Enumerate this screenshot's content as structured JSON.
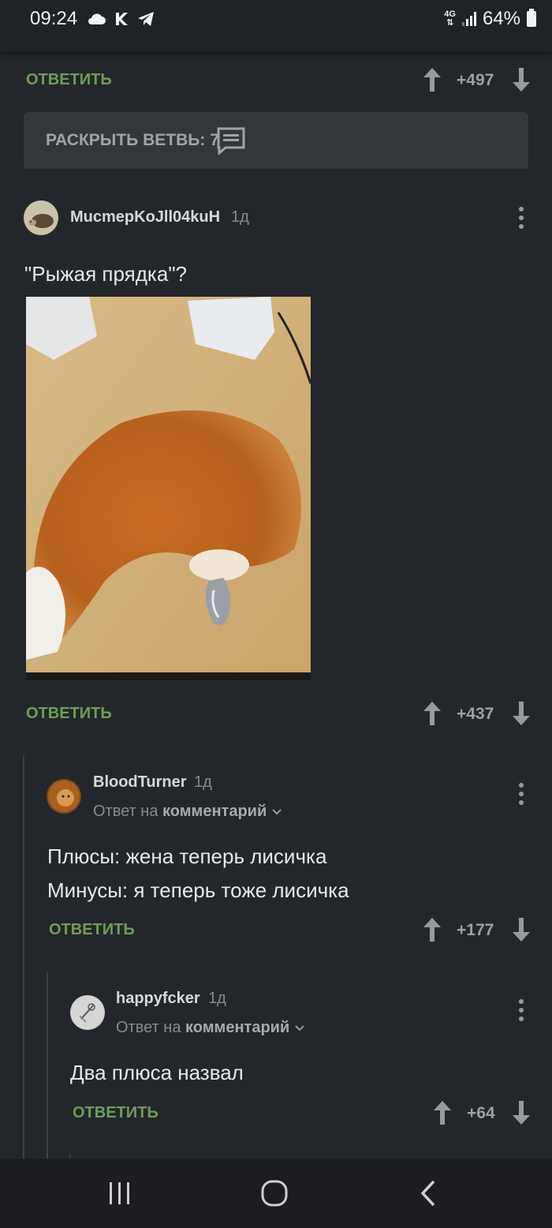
{
  "status_bar": {
    "time": "09:24",
    "left_icons": [
      "cloud-icon",
      "k-app-icon",
      "telegram-icon"
    ],
    "network": "4G",
    "battery": "64%"
  },
  "top_actions": {
    "reply_label": "ОТВЕТИТЬ",
    "score": "+497"
  },
  "expand_thread": {
    "label": "РАСКРЫТЬ ВЕТВЬ: 7",
    "icon": "comment-icon"
  },
  "comments": [
    {
      "username": "MucmepKoJll04kuH",
      "age": "1д",
      "text": "\"Рыжая прядка\"?",
      "image": "fox-tail-photo",
      "reply_label": "ОТВЕТИТЬ",
      "score": "+437"
    },
    {
      "username": "BloodTurner",
      "age": "1д",
      "reply_to_prefix": "Ответ на",
      "reply_to_link": "комментарий",
      "lines": [
        "Плюсы: жена теперь лисичка",
        "Минусы: я теперь тоже лисичка"
      ],
      "reply_label": "ОТВЕТИТЬ",
      "score": "+177"
    },
    {
      "username": "happyfcker",
      "age": "1д",
      "reply_to_prefix": "Ответ на",
      "reply_to_link": "комментарий",
      "text": "Два плюса назвал",
      "reply_label": "ОТВЕТИТЬ",
      "score": "+64"
    }
  ],
  "colors": {
    "background": "#23272b",
    "reply_green": "#6f9e55",
    "muted": "#8a8a8a"
  }
}
